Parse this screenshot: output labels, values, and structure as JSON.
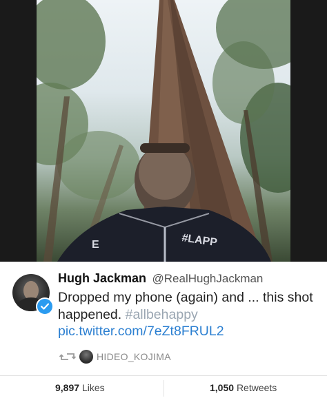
{
  "tweet": {
    "display_name": "Hugh Jackman",
    "handle": "@RealHughJackman",
    "text_part1": "Dropped my phone (again) and ... this shot happened. ",
    "hashtag": "#allbehappy",
    "link": "pic.twitter.com/7eZt8FRUL2",
    "retweeted_by": "HIDEO_KOJIMA"
  },
  "stats": {
    "likes_count": "9,897",
    "likes_label": "Likes",
    "retweets_count": "1,050",
    "retweets_label": "Retweets"
  },
  "photo": {
    "jacket_text_left": "E",
    "jacket_text_right": "#LAPP"
  },
  "colors": {
    "link": "#2b7fd1",
    "verified": "#2b9bf0",
    "hashtag": "#9aa6b2"
  }
}
